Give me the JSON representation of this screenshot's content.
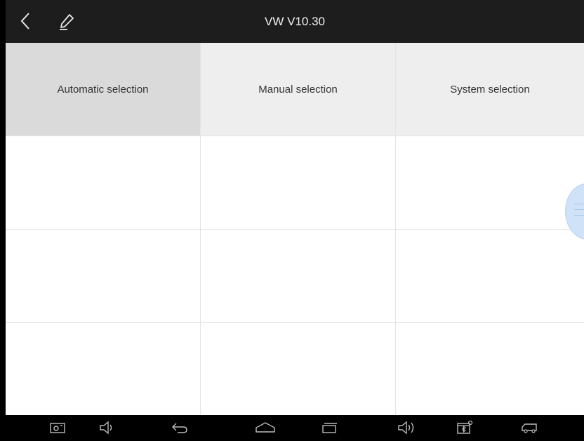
{
  "header": {
    "title": "VW V10.30"
  },
  "tabs": [
    {
      "label": "Automatic selection",
      "active": true
    },
    {
      "label": "Manual selection",
      "active": false
    },
    {
      "label": "System selection",
      "active": false
    }
  ],
  "colors": {
    "titlebar": "#1d1d1d",
    "tab_active": "#dadada",
    "tab_inactive": "#eeeeee",
    "navbar": "#000000"
  },
  "icons": {
    "header": [
      "back-icon",
      "edit-icon"
    ],
    "navbar": [
      "screenshot-icon",
      "volume-down-icon",
      "back-icon",
      "home-icon",
      "recent-apps-icon",
      "volume-up-icon",
      "vci-bluetooth-icon",
      "vehicle-icon"
    ]
  }
}
